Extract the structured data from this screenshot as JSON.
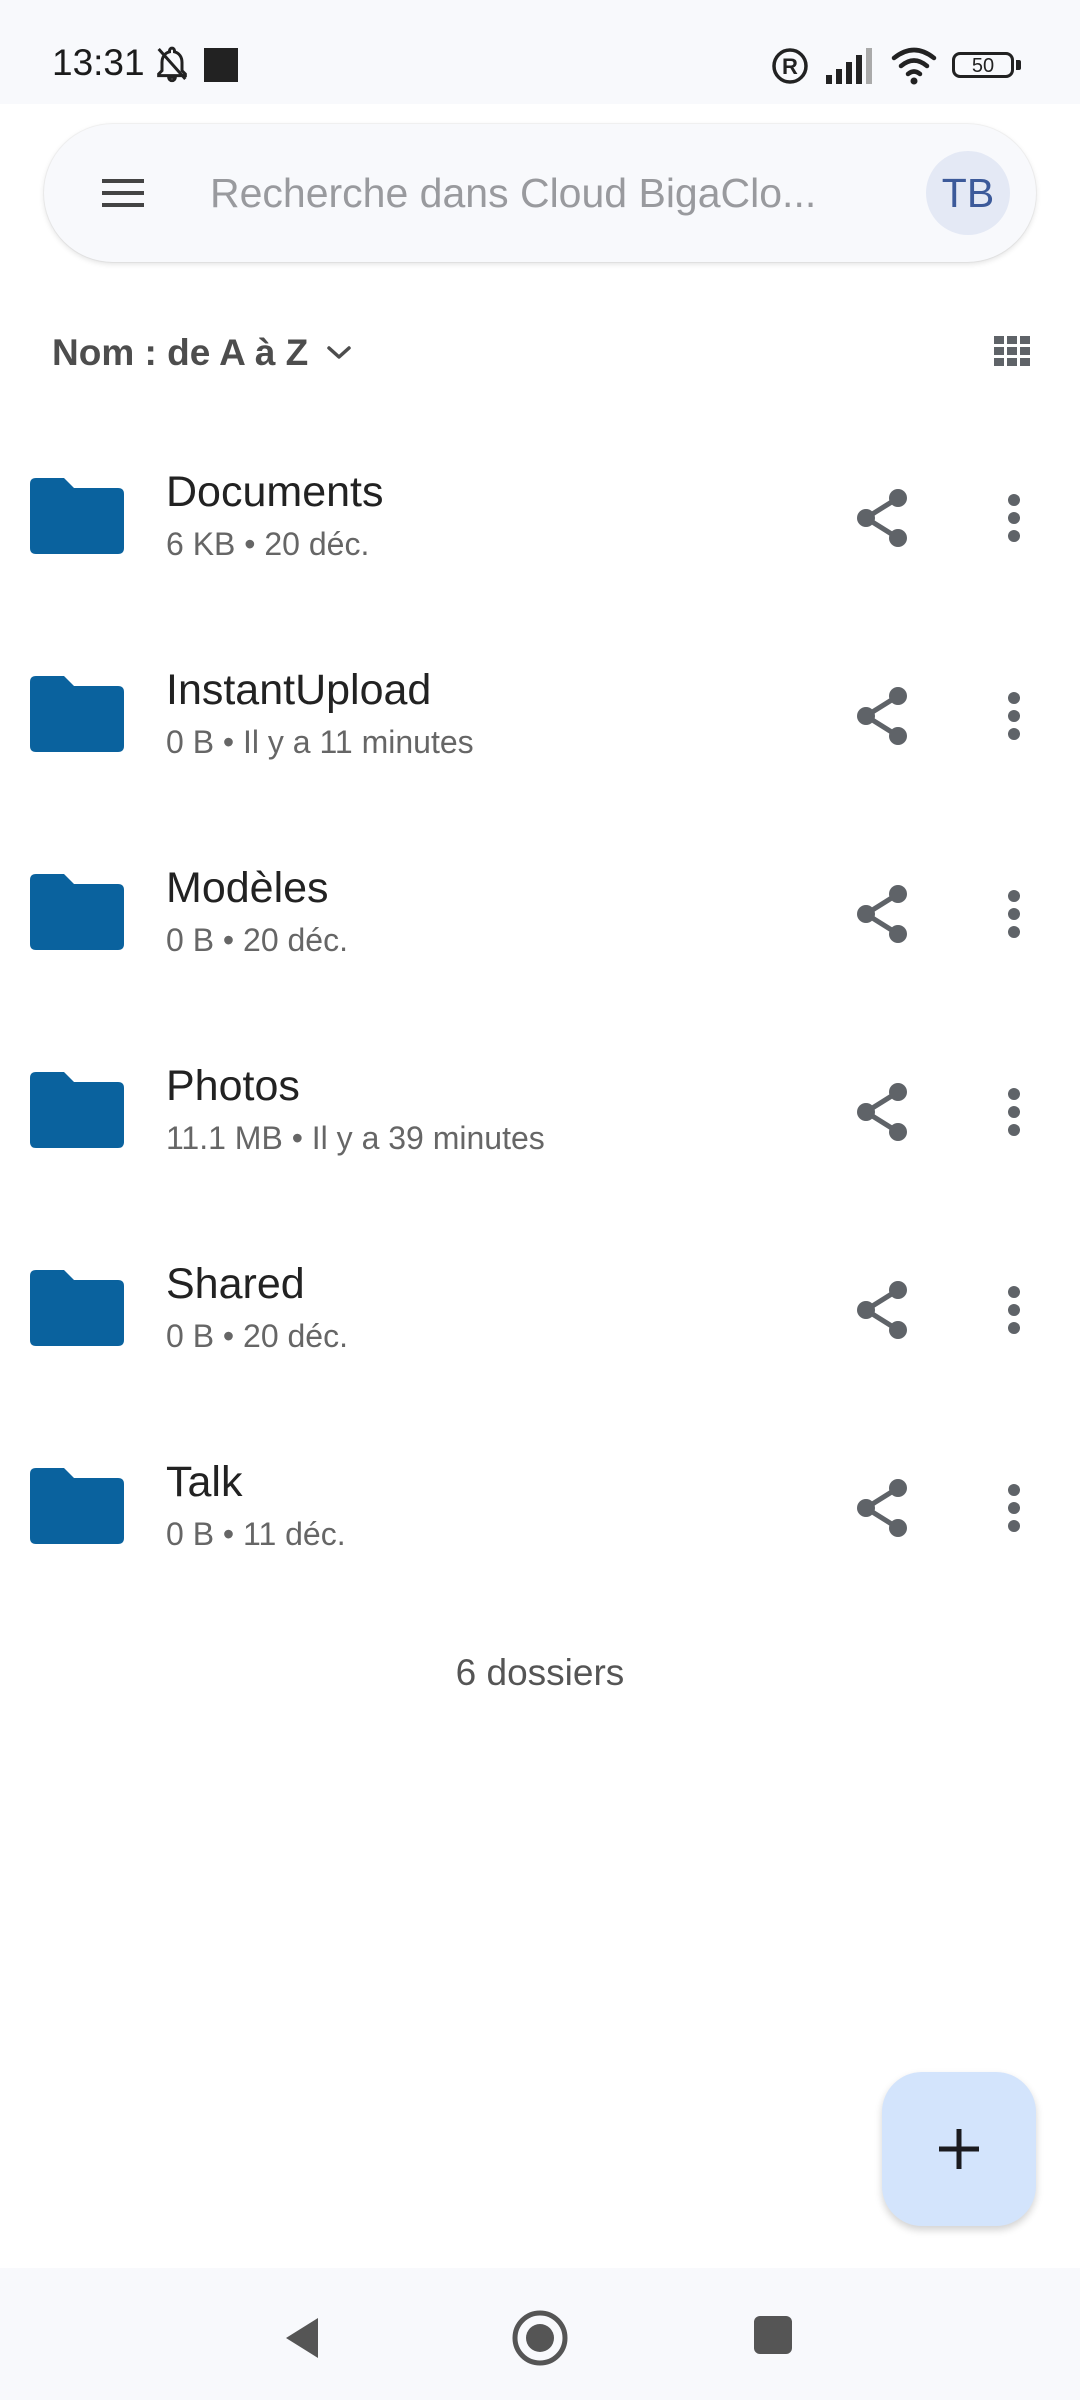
{
  "status_bar": {
    "time": "13:31",
    "battery": "50"
  },
  "search": {
    "placeholder": "Recherche dans Cloud BigaClo...",
    "avatar_initials": "TB"
  },
  "sort": {
    "label": "Nom : de A à Z"
  },
  "files": [
    {
      "name": "Documents",
      "meta": "6 KB • 20 déc."
    },
    {
      "name": "InstantUpload",
      "meta": "0 B • Il y a 11 minutes"
    },
    {
      "name": "Modèles",
      "meta": "0 B • 20 déc."
    },
    {
      "name": "Photos",
      "meta": "11.1 MB • Il y a 39 minutes"
    },
    {
      "name": "Shared",
      "meta": "0 B • 20 déc."
    },
    {
      "name": "Talk",
      "meta": "0 B • 11 déc."
    }
  ],
  "footer": {
    "count": "6 dossiers"
  },
  "colors": {
    "folder": "#0a629e",
    "fab": "#d3e4fc",
    "icon_gray": "#5f6368"
  }
}
